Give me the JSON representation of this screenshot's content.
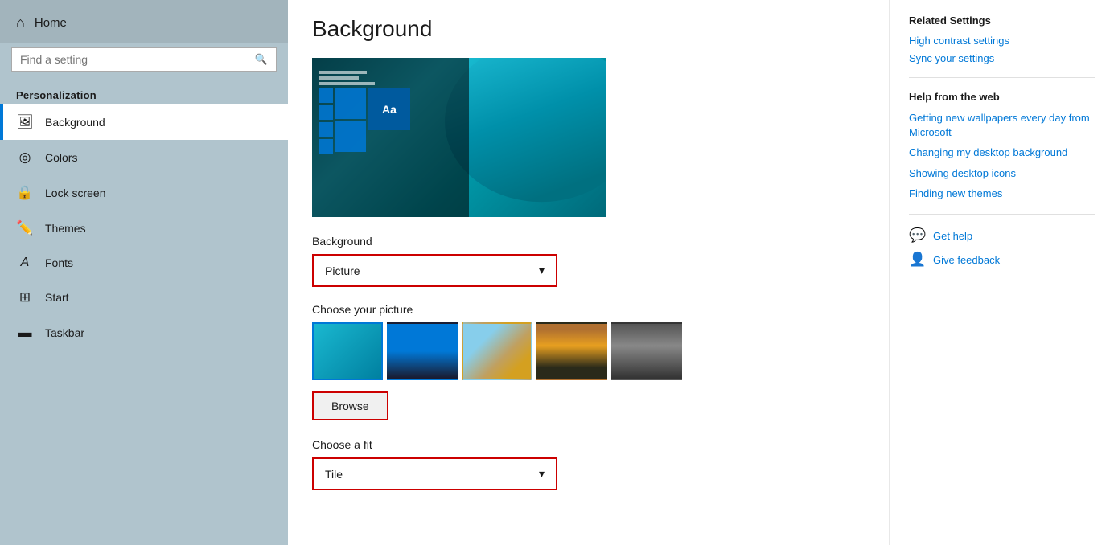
{
  "sidebar": {
    "home_label": "Home",
    "search_placeholder": "Find a setting",
    "section_title": "Personalization",
    "nav_items": [
      {
        "id": "background",
        "label": "Background",
        "icon": "🖼",
        "active": true
      },
      {
        "id": "colors",
        "label": "Colors",
        "icon": "🎨",
        "active": false
      },
      {
        "id": "lock-screen",
        "label": "Lock screen",
        "icon": "🔒",
        "active": false
      },
      {
        "id": "themes",
        "label": "Themes",
        "icon": "✏",
        "active": false
      },
      {
        "id": "fonts",
        "label": "Fonts",
        "icon": "A",
        "active": false
      },
      {
        "id": "start",
        "label": "Start",
        "icon": "⊞",
        "active": false
      },
      {
        "id": "taskbar",
        "label": "Taskbar",
        "icon": "▬",
        "active": false
      }
    ]
  },
  "main": {
    "page_title": "Background",
    "background_label": "Background",
    "background_dropdown_value": "Picture",
    "choose_picture_label": "Choose your picture",
    "browse_label": "Browse",
    "choose_fit_label": "Choose a fit",
    "fit_dropdown_value": "Tile"
  },
  "right_panel": {
    "related_title": "Related Settings",
    "related_links": [
      {
        "label": "High contrast settings"
      },
      {
        "label": "Sync your settings"
      }
    ],
    "help_title": "Help from the web",
    "help_links": [
      {
        "label": "Getting new wallpapers every day from Microsoft"
      },
      {
        "label": "Changing my desktop background"
      },
      {
        "label": "Showing desktop icons"
      },
      {
        "label": "Finding new themes"
      }
    ],
    "get_help_label": "Get help",
    "give_feedback_label": "Give feedback"
  }
}
